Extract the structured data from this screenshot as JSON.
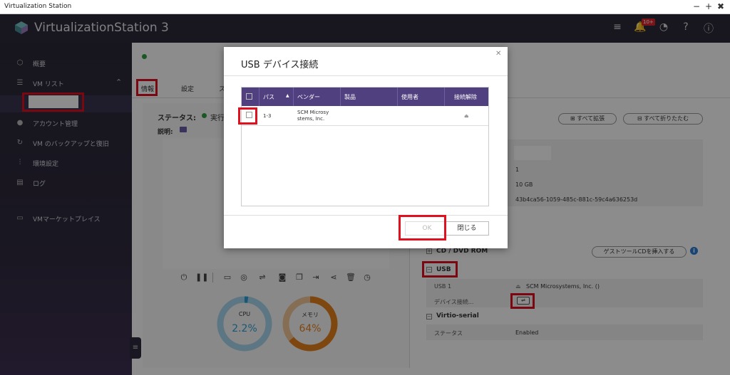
{
  "window": {
    "title": "Virtualization Station"
  },
  "app": {
    "name": "VirtualizationStation 3",
    "notification_badge": "10+"
  },
  "sidebar": {
    "items": [
      {
        "label": "概要",
        "icon": "overview-icon"
      },
      {
        "label": "VM リスト",
        "icon": "list-icon"
      },
      {
        "label": "アカウント管理",
        "icon": "user-icon"
      },
      {
        "label": "VM のバックアップと復旧",
        "icon": "backup-icon"
      },
      {
        "label": "環境設定",
        "icon": "settings-icon"
      },
      {
        "label": "ログ",
        "icon": "log-icon"
      },
      {
        "label": "VMマーケットプレイス",
        "icon": "marketplace-icon"
      }
    ]
  },
  "main": {
    "tabs": [
      {
        "label": "情報"
      },
      {
        "label": "設定"
      },
      {
        "label": "ス"
      }
    ],
    "status_label": "ステータス:",
    "status_value": "実行",
    "desc_label": "説明:",
    "gauges": {
      "cpu": {
        "label": "CPU",
        "value": "2.2%",
        "fraction": 0.022
      },
      "mem": {
        "label": "メモリ",
        "value": "64%",
        "fraction": 0.64
      }
    }
  },
  "right": {
    "expand_all": "すべて拡張",
    "collapse_all": "すべて折りたたむ",
    "info_rows": [
      "1",
      "10 GB",
      "43b4ca56-1059-485c-881c-59c4a636253d"
    ],
    "cd_title": "CD / DVD ROM",
    "guest_tools_btn": "ゲストツールCDを挿入する",
    "usb_title": "USB",
    "usb_row_label": "USB 1",
    "usb_row_value": "SCM Microsystems, Inc. ()",
    "device_connect_label": "デバイス接続...",
    "virtio_title": "Virtio-serial",
    "virtio_status_label": "ステータス",
    "virtio_status_value": "Enabled"
  },
  "modal": {
    "title": "USB デバイス接続",
    "columns": [
      "パス",
      "ベンダー",
      "製品",
      "使用者",
      "接続解除"
    ],
    "rows": [
      {
        "path": "1-3",
        "vendor_line1": "SCM Microsy",
        "vendor_line2": "stems, Inc.",
        "product": "",
        "user": ""
      }
    ],
    "ok": "OK",
    "close": "閉じる"
  },
  "colors": {
    "accent": "#51407f",
    "highlight": "#e0101e",
    "cpu": "#2f9fd8",
    "mem": "#e8821e"
  }
}
